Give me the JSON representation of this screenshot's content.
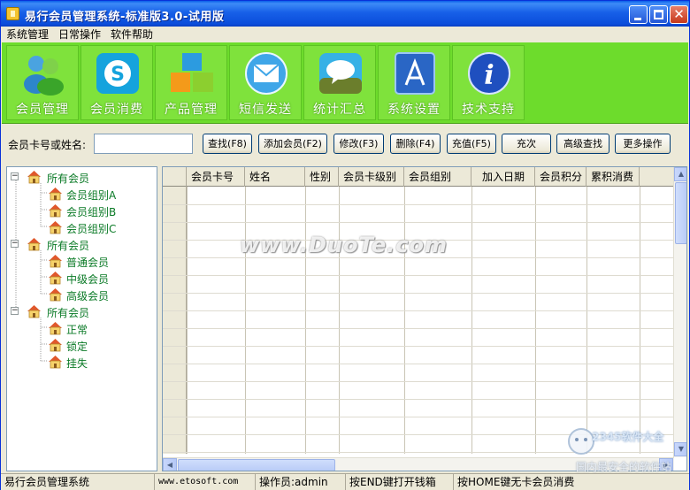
{
  "window": {
    "title": "易行会员管理系统-标准版3.0-试用版"
  },
  "menu": [
    {
      "label": "系统管理"
    },
    {
      "label": "日常操作"
    },
    {
      "label": "软件帮助"
    }
  ],
  "toolbar": {
    "background": "#6ddc2c",
    "items": [
      {
        "label": "会员管理",
        "icon": "people-icon"
      },
      {
        "label": "会员消费",
        "icon": "skype-icon"
      },
      {
        "label": "产品管理",
        "icon": "blocks-icon"
      },
      {
        "label": "短信发送",
        "icon": "mail-icon"
      },
      {
        "label": "统计汇总",
        "icon": "chat-icon"
      },
      {
        "label": "系统设置",
        "icon": "appstore-icon"
      },
      {
        "label": "技术支持",
        "icon": "info-icon"
      }
    ]
  },
  "search": {
    "label": "会员卡号或姓名:",
    "value": "",
    "buttons": [
      {
        "label": "查找(F8)"
      },
      {
        "label": "添加会员(F2)"
      },
      {
        "label": "修改(F3)"
      },
      {
        "label": "删除(F4)"
      },
      {
        "label": "充值(F5)"
      },
      {
        "label": "充次"
      },
      {
        "label": "高级查找"
      },
      {
        "label": "更多操作"
      }
    ]
  },
  "tree": [
    {
      "label": "所有会员",
      "expander": "−",
      "children": [
        {
          "label": "会员组别A"
        },
        {
          "label": "会员组别B"
        },
        {
          "label": "会员组别C"
        }
      ]
    },
    {
      "label": "所有会员",
      "expander": "−",
      "children": [
        {
          "label": "普通会员"
        },
        {
          "label": "中级会员"
        },
        {
          "label": "高级会员"
        }
      ]
    },
    {
      "label": "所有会员",
      "expander": "−",
      "children": [
        {
          "label": "正常"
        },
        {
          "label": "锁定"
        },
        {
          "label": "挂失"
        }
      ]
    }
  ],
  "grid": {
    "columns": [
      {
        "label": "会员卡号"
      },
      {
        "label": "姓名"
      },
      {
        "label": "性别"
      },
      {
        "label": "会员卡级别"
      },
      {
        "label": "会员组别"
      },
      {
        "label": "加入日期"
      },
      {
        "label": "会员积分"
      },
      {
        "label": "累积消费"
      }
    ],
    "rows": []
  },
  "watermarks": {
    "center": "www.DuoTe.com",
    "corner_brand": "2345软件大全",
    "corner_slogan": "国内最安全的软件站"
  },
  "statusbar": [
    {
      "text": "易行会员管理系统"
    },
    {
      "text": "www.etosoft.com"
    },
    {
      "text": "操作员:admin"
    },
    {
      "text": "按END键打开钱箱"
    },
    {
      "text": "按HOME键无卡会员消费"
    }
  ]
}
